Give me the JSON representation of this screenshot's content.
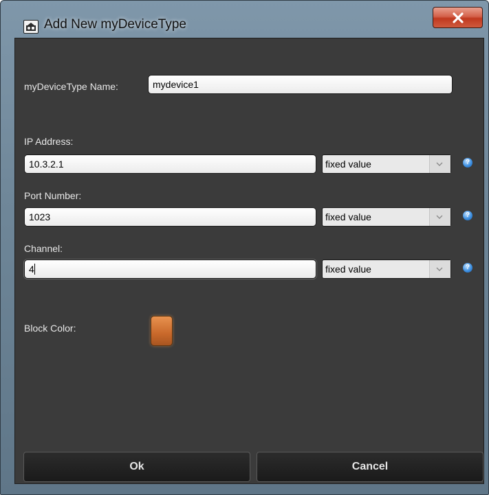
{
  "window": {
    "title": "Add New myDeviceType",
    "icon": "device-app-icon",
    "close_icon": "close-icon",
    "close_color": "#c73b20"
  },
  "form": {
    "name_label": "myDeviceType Name:",
    "name_value": "mydevice1",
    "fields": [
      {
        "label": "IP Address:",
        "value": "10.3.2.1",
        "mode": "fixed value"
      },
      {
        "label": "Port Number:",
        "value": "1023",
        "mode": "fixed value"
      },
      {
        "label": "Channel:",
        "value": "4",
        "mode": "fixed value"
      }
    ],
    "help_icon": "?",
    "block_color_label": "Block Color:",
    "block_color": "#c9692b"
  },
  "buttons": {
    "ok": "Ok",
    "cancel": "Cancel"
  }
}
